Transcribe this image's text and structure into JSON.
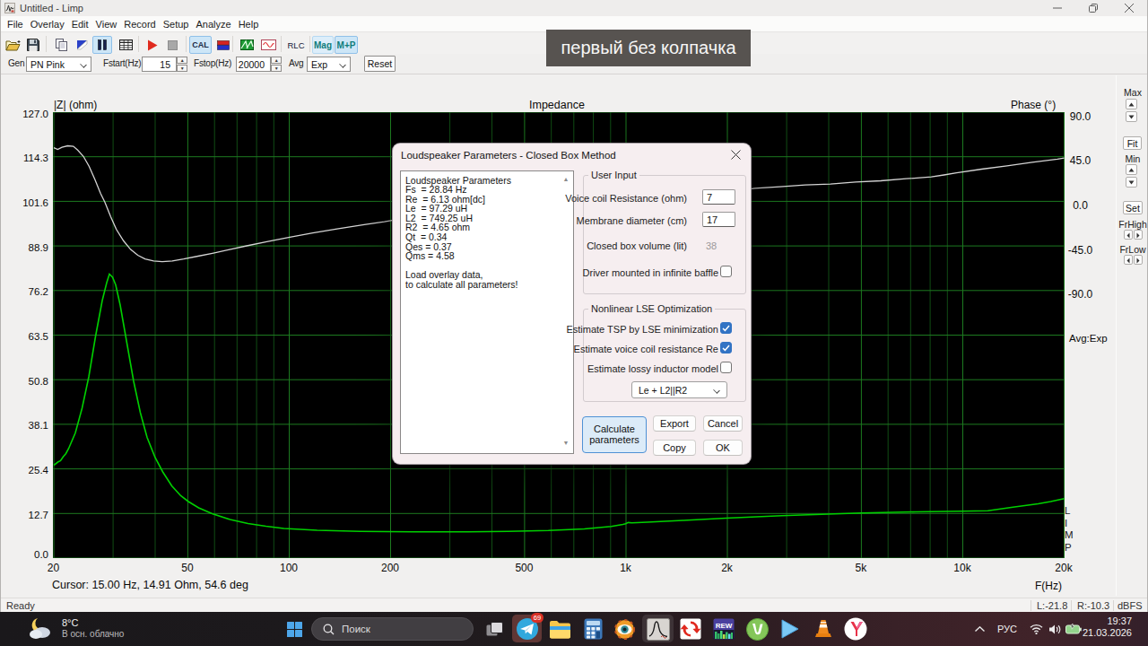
{
  "colors": {
    "accent_blue": "#3273c4",
    "curve_green": "#00d000",
    "curve_phase": "#d4d4d4",
    "grid_major": "#1d7a20",
    "grid_minor": "#114d14",
    "caption_bg": "#575350",
    "attention_red": "#e8807d"
  },
  "window": {
    "title": "Untitled - Limp",
    "controls": {
      "minimize": "minimize",
      "maximize": "restore",
      "close": "close"
    }
  },
  "menu": {
    "items": [
      "File",
      "Overlay",
      "Edit",
      "View",
      "Record",
      "Setup",
      "Analyze",
      "Help"
    ]
  },
  "toolbar": {
    "cal_label": "CAL",
    "rlc_label": "RLC",
    "mag_label": "Mag",
    "mp_label": "M+P",
    "icons": [
      "open",
      "save",
      "copy",
      "overlay-flag",
      "pause",
      "table",
      "play",
      "stop",
      "cal",
      "gen-flag",
      "spectrum",
      "sine",
      "rlc",
      "mag",
      "m+p"
    ]
  },
  "genbar": {
    "gen_label": "Gen",
    "gen_value": "PN Pink",
    "fstart_label": "Fstart(Hz)",
    "fstart_value": "15",
    "fstop_label": "Fstop(Hz)",
    "fstop_value": "20000",
    "avg_label": "Avg",
    "avg_value": "Exp",
    "reset_label": "Reset"
  },
  "chart": {
    "title": "Impedance",
    "left_axis_label": "|Z| (ohm)",
    "right_axis_label": "Phase (°)",
    "freq_axis_label": "F(Hz)",
    "cursor_text": "Cursor: 15.00 Hz, 14.91 Ohm, 54.6 deg",
    "watermark": [
      "L",
      "I",
      "M",
      "P"
    ],
    "avg_text": "Avg:Exp"
  },
  "chart_data": {
    "type": "line",
    "title": "Impedance",
    "xlabel": "F(Hz)",
    "x_scale": "log",
    "xlim": [
      20,
      20000
    ],
    "x_ticks": [
      {
        "v": 20,
        "label": "20"
      },
      {
        "v": 50,
        "label": "50"
      },
      {
        "v": 100,
        "label": "100"
      },
      {
        "v": 200,
        "label": "200"
      },
      {
        "v": 500,
        "label": "500"
      },
      {
        "v": 1000,
        "label": "1k"
      },
      {
        "v": 2000,
        "label": "2k"
      },
      {
        "v": 5000,
        "label": "5k"
      },
      {
        "v": 10000,
        "label": "10k"
      },
      {
        "v": 20000,
        "label": "20k"
      }
    ],
    "y_left": {
      "label": "|Z| (ohm)",
      "min": 0.0,
      "max": 127.0,
      "ticks": [
        "127.0",
        "114.3",
        "101.6",
        "88.9",
        "76.2",
        "63.5",
        "50.8",
        "38.1",
        "25.4",
        "12.7",
        "0.0"
      ]
    },
    "y_right": {
      "label": "Phase (°)",
      "deg_per_division": 45,
      "ticks": [
        "90.0",
        "45.0",
        "0.0",
        "-45.0",
        "-90.0"
      ]
    },
    "grid": true,
    "series": [
      {
        "name": "impedance_ohm",
        "color": "#00d000",
        "points": [
          [
            20.0,
            26.45
          ],
          [
            20.56,
            27.34
          ],
          [
            20.94,
            27.73
          ],
          [
            21.33,
            28.88
          ],
          [
            21.73,
            29.77
          ],
          [
            22.13,
            31.18
          ],
          [
            23.17,
            35.65
          ],
          [
            24.26,
            42.67
          ],
          [
            25.4,
            51.62
          ],
          [
            26.6,
            63.12
          ],
          [
            27.85,
            73.34
          ],
          [
            28.72,
            78.45
          ],
          [
            29.25,
            80.88
          ],
          [
            29.89,
            79.98
          ],
          [
            30.53,
            77.81
          ],
          [
            31.48,
            72.06
          ],
          [
            32.97,
            61.2
          ],
          [
            34.52,
            50.34
          ],
          [
            36.14,
            41.4
          ],
          [
            37.84,
            34.37
          ],
          [
            39.99,
            28.62
          ],
          [
            42.13,
            24.53
          ],
          [
            44.8,
            20.57
          ],
          [
            47.63,
            17.76
          ],
          [
            50.18,
            16.1
          ],
          [
            53.84,
            14.31
          ],
          [
            59.03,
            12.65
          ],
          [
            66.73,
            10.99
          ],
          [
            75.44,
            9.84
          ],
          [
            85.28,
            9.07
          ],
          [
            96.41,
            8.43
          ],
          [
            120.96,
            7.92
          ],
          [
            162.36,
            7.59
          ],
          [
            234.57,
            7.46
          ],
          [
            338.89,
            7.49
          ],
          [
            446.58,
            7.59
          ],
          [
            588.49,
            7.84
          ],
          [
            752.08,
            8.3
          ],
          [
            903.98,
            8.99
          ],
          [
            978.99,
            9.58
          ],
          [
            997.16,
            9.75
          ],
          [
            1015.68,
            10.12
          ],
          [
            1040.9,
            10.02
          ],
          [
            1155.26,
            10.22
          ],
          [
            1476.41,
            10.73
          ],
          [
            1981.69,
            11.37
          ],
          [
            2898.33,
            12.06
          ],
          [
            5002.25,
            12.83
          ],
          [
            7271.36,
            13.16
          ],
          [
            9941.11,
            13.34
          ],
          [
            11875.86,
            13.49
          ],
          [
            14100.43,
            14.49
          ],
          [
            16741.7,
            15.46
          ],
          [
            18242.45,
            16.1
          ],
          [
            20000.0,
            16.92
          ]
        ]
      },
      {
        "name": "phase_deg",
        "color": "#d4d4d4",
        "points": [
          [
            20.0,
            54.0
          ],
          [
            20.53,
            52.2
          ],
          [
            21.15,
            54.5
          ],
          [
            21.99,
            56.0
          ],
          [
            22.86,
            55.4
          ],
          [
            23.54,
            51.6
          ],
          [
            24.49,
            45.3
          ],
          [
            25.47,
            35.1
          ],
          [
            26.49,
            22.1
          ],
          [
            27.55,
            7.7
          ],
          [
            28.37,
            -1.0
          ],
          [
            29.5,
            -15.5
          ],
          [
            30.68,
            -28.5
          ],
          [
            32.23,
            -40.0
          ],
          [
            33.83,
            -48.7
          ],
          [
            35.53,
            -54.5
          ],
          [
            37.31,
            -58.3
          ],
          [
            39.58,
            -60.3
          ],
          [
            41.98,
            -60.9
          ],
          [
            44.96,
            -60.3
          ],
          [
            48.6,
            -58.3
          ],
          [
            53.61,
            -55.4
          ],
          [
            59.14,
            -52.5
          ],
          [
            66.53,
            -48.7
          ],
          [
            74.79,
            -45.0
          ],
          [
            85.81,
            -40.7
          ],
          [
            100.39,
            -36.3
          ],
          [
            117.46,
            -32.0
          ],
          [
            140.06,
            -27.6
          ],
          [
            167.01,
            -23.5
          ],
          [
            191.6,
            -20.6
          ],
          [
            209.28,
            -18.4
          ],
          [
            249.4,
            -15.4
          ],
          [
            318.73,
            -11.9
          ],
          [
            407.33,
            -8.8
          ],
          [
            553.49,
            -5.3
          ],
          [
            752.08,
            -2.3
          ],
          [
            1021.92,
            0.8
          ],
          [
            1388.59,
            4.1
          ],
          [
            1886.82,
            8.1
          ],
          [
            2411.32,
            13.0
          ],
          [
            2864.76,
            14.6
          ],
          [
            3405.56,
            16.4
          ],
          [
            4045.96,
            17.4
          ],
          [
            4806.79,
            19.4
          ],
          [
            5710.7,
            20.6
          ],
          [
            6788.74,
            22.7
          ],
          [
            8065.34,
            24.5
          ],
          [
            8793.72,
            26.5
          ],
          [
            9582.0,
            28.6
          ],
          [
            11383.86,
            32.4
          ],
          [
            13532.86,
            35.7
          ],
          [
            16077.67,
            39.3
          ],
          [
            19101.02,
            42.6
          ],
          [
            20000.0,
            43.6
          ]
        ]
      }
    ]
  },
  "side_panel": {
    "max_label": "Max",
    "fit_label": "Fit",
    "min_label": "Min",
    "set_label": "Set",
    "frhigh_label": "FrHigh",
    "frlow_label": "FrLow"
  },
  "status_bar": {
    "ready": "Ready",
    "left_level": "L:-21.8",
    "right_level": "R:-10.3",
    "unit": "dBFS"
  },
  "caption_overlay": {
    "text": "первый без колпачка"
  },
  "dialog": {
    "title": "Loudspeaker Parameters - Closed Box Method",
    "close_label": "×",
    "params_text": [
      "Loudspeaker Parameters",
      "Fs  = 28.84 Hz",
      "Re  = 6.13 ohm[dc]",
      "Le  = 97.29 uH",
      "L2  = 749.25 uH",
      "R2  = 4.65 ohm",
      "Qt  = 0.34",
      "Qes = 0.37",
      "Qms = 4.58",
      "",
      "Load overlay data,",
      "to calculate all parameters!"
    ],
    "user_input": {
      "title": "User Input",
      "rows": [
        {
          "label": "Voice coil Resistance (ohm)",
          "value": "7",
          "disabled": false
        },
        {
          "label": "Membrane diameter (cm)",
          "value": "17",
          "disabled": false
        },
        {
          "label": "Closed box volume (lit)",
          "value": "38",
          "disabled": true
        }
      ],
      "baffle_label": "Driver mounted in infinite baffle",
      "baffle_checked": false
    },
    "lse": {
      "title": "Nonlinear LSE Optimization",
      "checks": [
        {
          "label": "Estimate TSP by LSE minimization",
          "checked": true
        },
        {
          "label": "Estimate voice coil resistance Re",
          "checked": true
        },
        {
          "label": "Estimate lossy inductor model",
          "checked": false
        }
      ],
      "model_value": "Le + L2||R2"
    },
    "buttons": {
      "calculate": "Calculate\nparameters",
      "export": "Export",
      "cancel": "Cancel",
      "copy": "Copy",
      "ok": "OK"
    }
  },
  "taskbar": {
    "weather": {
      "temp": "8°C",
      "condition": "В осн. облачно"
    },
    "search_placeholder": "Поиск",
    "telegram_badge": "69",
    "icons": [
      "task-view",
      "telegram",
      "file-explorer",
      "calculator",
      "eye-app",
      "arta-limp",
      "backup-arrows",
      "rew",
      "utorrent",
      "media-play",
      "vlc",
      "yandex-browser"
    ],
    "tray": {
      "language": "РУС",
      "time": "19:37",
      "date": "21.03.2026"
    }
  }
}
